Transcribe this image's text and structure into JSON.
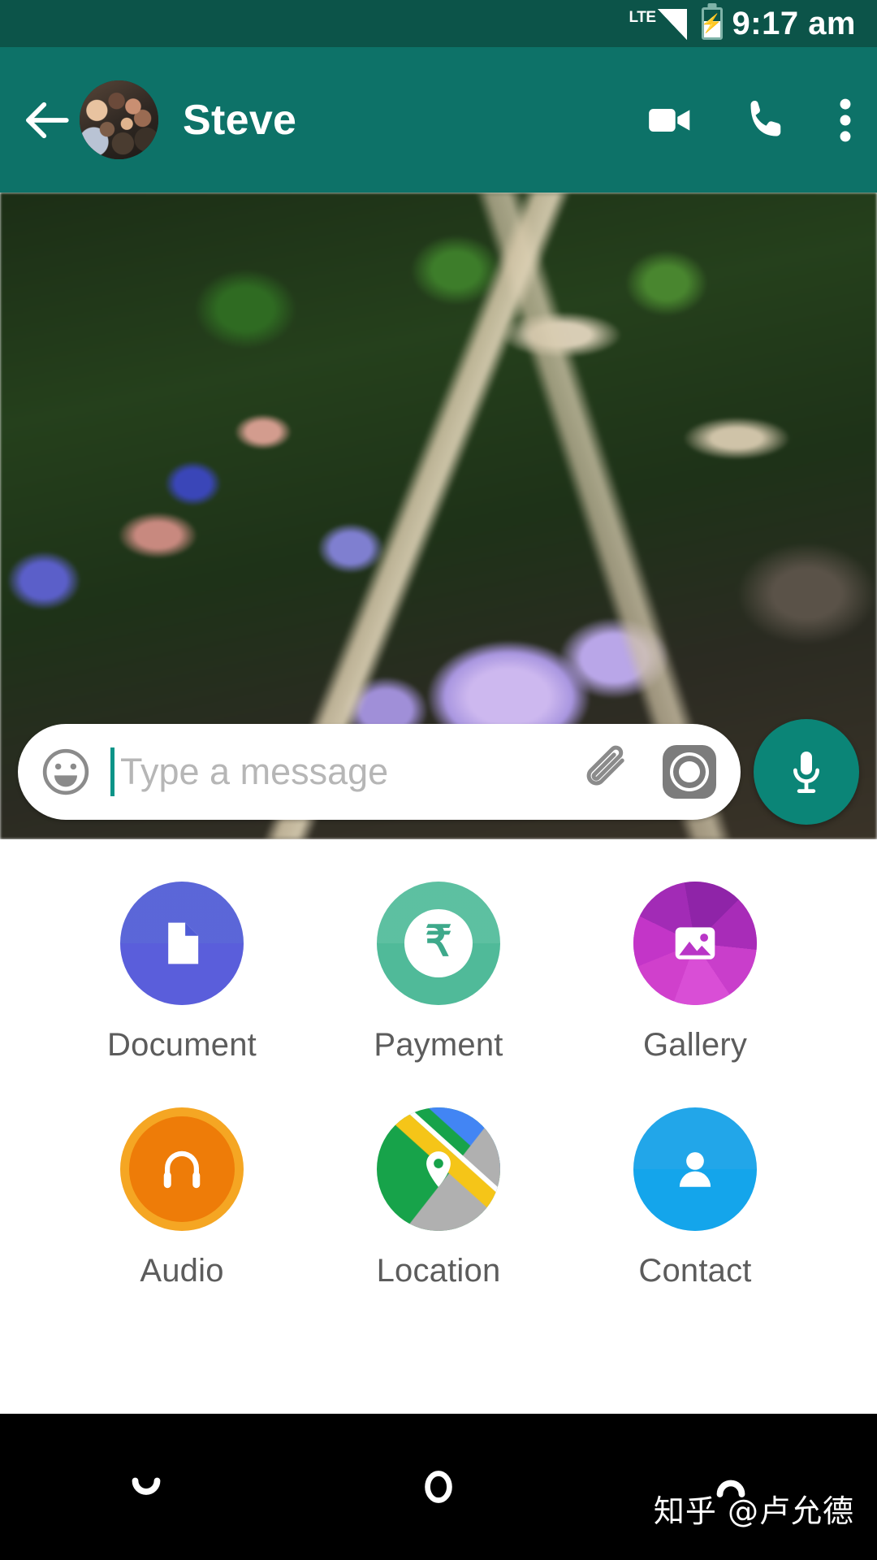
{
  "status_bar": {
    "network_label": "LTE",
    "signal_icon": "signal-triangle-icon",
    "battery_icon": "battery-charging-icon",
    "time": "9:17 am"
  },
  "header": {
    "back_icon": "back-arrow-icon",
    "avatar_icon": "contact-avatar",
    "title": "Steve",
    "actions": [
      {
        "name": "video-call-icon",
        "label": "Video call"
      },
      {
        "name": "voice-call-icon",
        "label": "Voice call"
      },
      {
        "name": "overflow-menu-icon",
        "label": "More options"
      }
    ]
  },
  "chat": {
    "wallpaper_description": "blurred purple flowers and green foliage photo wallpaper"
  },
  "input_bar": {
    "emoji_icon": "emoji-smiley-icon",
    "placeholder": "Type a message",
    "value": "",
    "attach_icon": "paperclip-icon",
    "camera_icon": "camera-icon",
    "mic_icon": "microphone-icon"
  },
  "attach_panel": {
    "items": [
      {
        "label": "Document",
        "icon": "document-icon",
        "color": "#4f5bd5"
      },
      {
        "label": "Payment",
        "icon": "rupee-payment-icon",
        "color": "#54bd9c"
      },
      {
        "label": "Gallery",
        "icon": "gallery-image-icon",
        "color": "#b935c7"
      },
      {
        "label": "Audio",
        "icon": "headphones-icon",
        "color": "#f5a623"
      },
      {
        "label": "Location",
        "icon": "map-pin-icon",
        "color": "#17a34a"
      },
      {
        "label": "Contact",
        "icon": "person-icon",
        "color": "#14a0e8"
      }
    ]
  },
  "nav_bar": {
    "back_icon": "nav-back-icon",
    "home_icon": "nav-home-icon",
    "recents_icon": "nav-recents-icon"
  },
  "watermark": {
    "text": "知乎 @卢允德"
  },
  "theme": {
    "status_bar_bg": "#0c5449",
    "header_bg": "#0d7268",
    "accent": "#0b8577",
    "panel_bg": "#ffffff",
    "label_color": "#5c5c5c",
    "nav_bg": "#000000"
  }
}
